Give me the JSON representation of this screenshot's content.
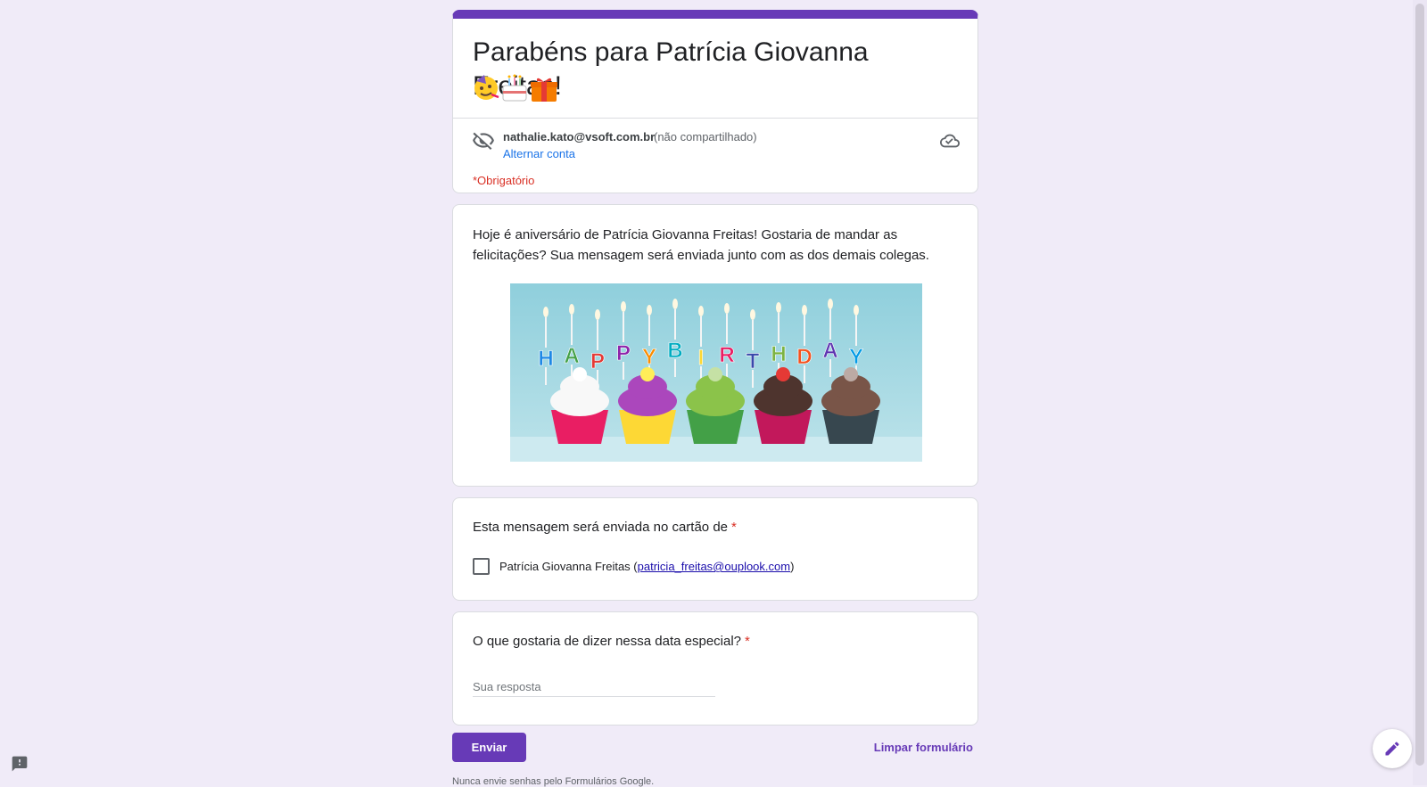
{
  "form": {
    "title": "Parabéns para Patrícia Giovanna Freitas!",
    "title_emojis": [
      "partying-face",
      "birthday-cake",
      "wrapped-gift"
    ],
    "accent_color": "#673ab7",
    "background_color": "#f0ebf8"
  },
  "account": {
    "email": "nathalie.kato@vsoft.com.br",
    "sharing_note": "(não compartilhado)",
    "switch_label": "Alternar conta",
    "visibility_icon": "eye-off-icon",
    "save_icon": "cloud-check-icon"
  },
  "required_note": "*Obrigatório",
  "description": {
    "text": "Hoje é aniversário de Patrícia Giovanna Freitas! Gostaria de mandar as felicitações? Sua mensagem será enviada junto com as dos demais colegas.",
    "banner_letters": "HAPPYBIRTHDAY"
  },
  "questions": [
    {
      "text": "Esta mensagem será enviada no cartão de",
      "required": "*",
      "option": {
        "name": "Patrícia Giovanna Freitas",
        "open": " (",
        "email": "patricia_freitas@ouplook.com",
        "close": ")",
        "checked": false
      }
    },
    {
      "text": "O que gostaria de dizer nessa data especial?",
      "required": "*",
      "placeholder": "Sua resposta",
      "value": ""
    }
  ],
  "actions": {
    "submit_label": "Enviar",
    "clear_label": "Limpar formulário"
  },
  "footer": {
    "note": "Nunca envie senhas pelo Formulários Google."
  }
}
